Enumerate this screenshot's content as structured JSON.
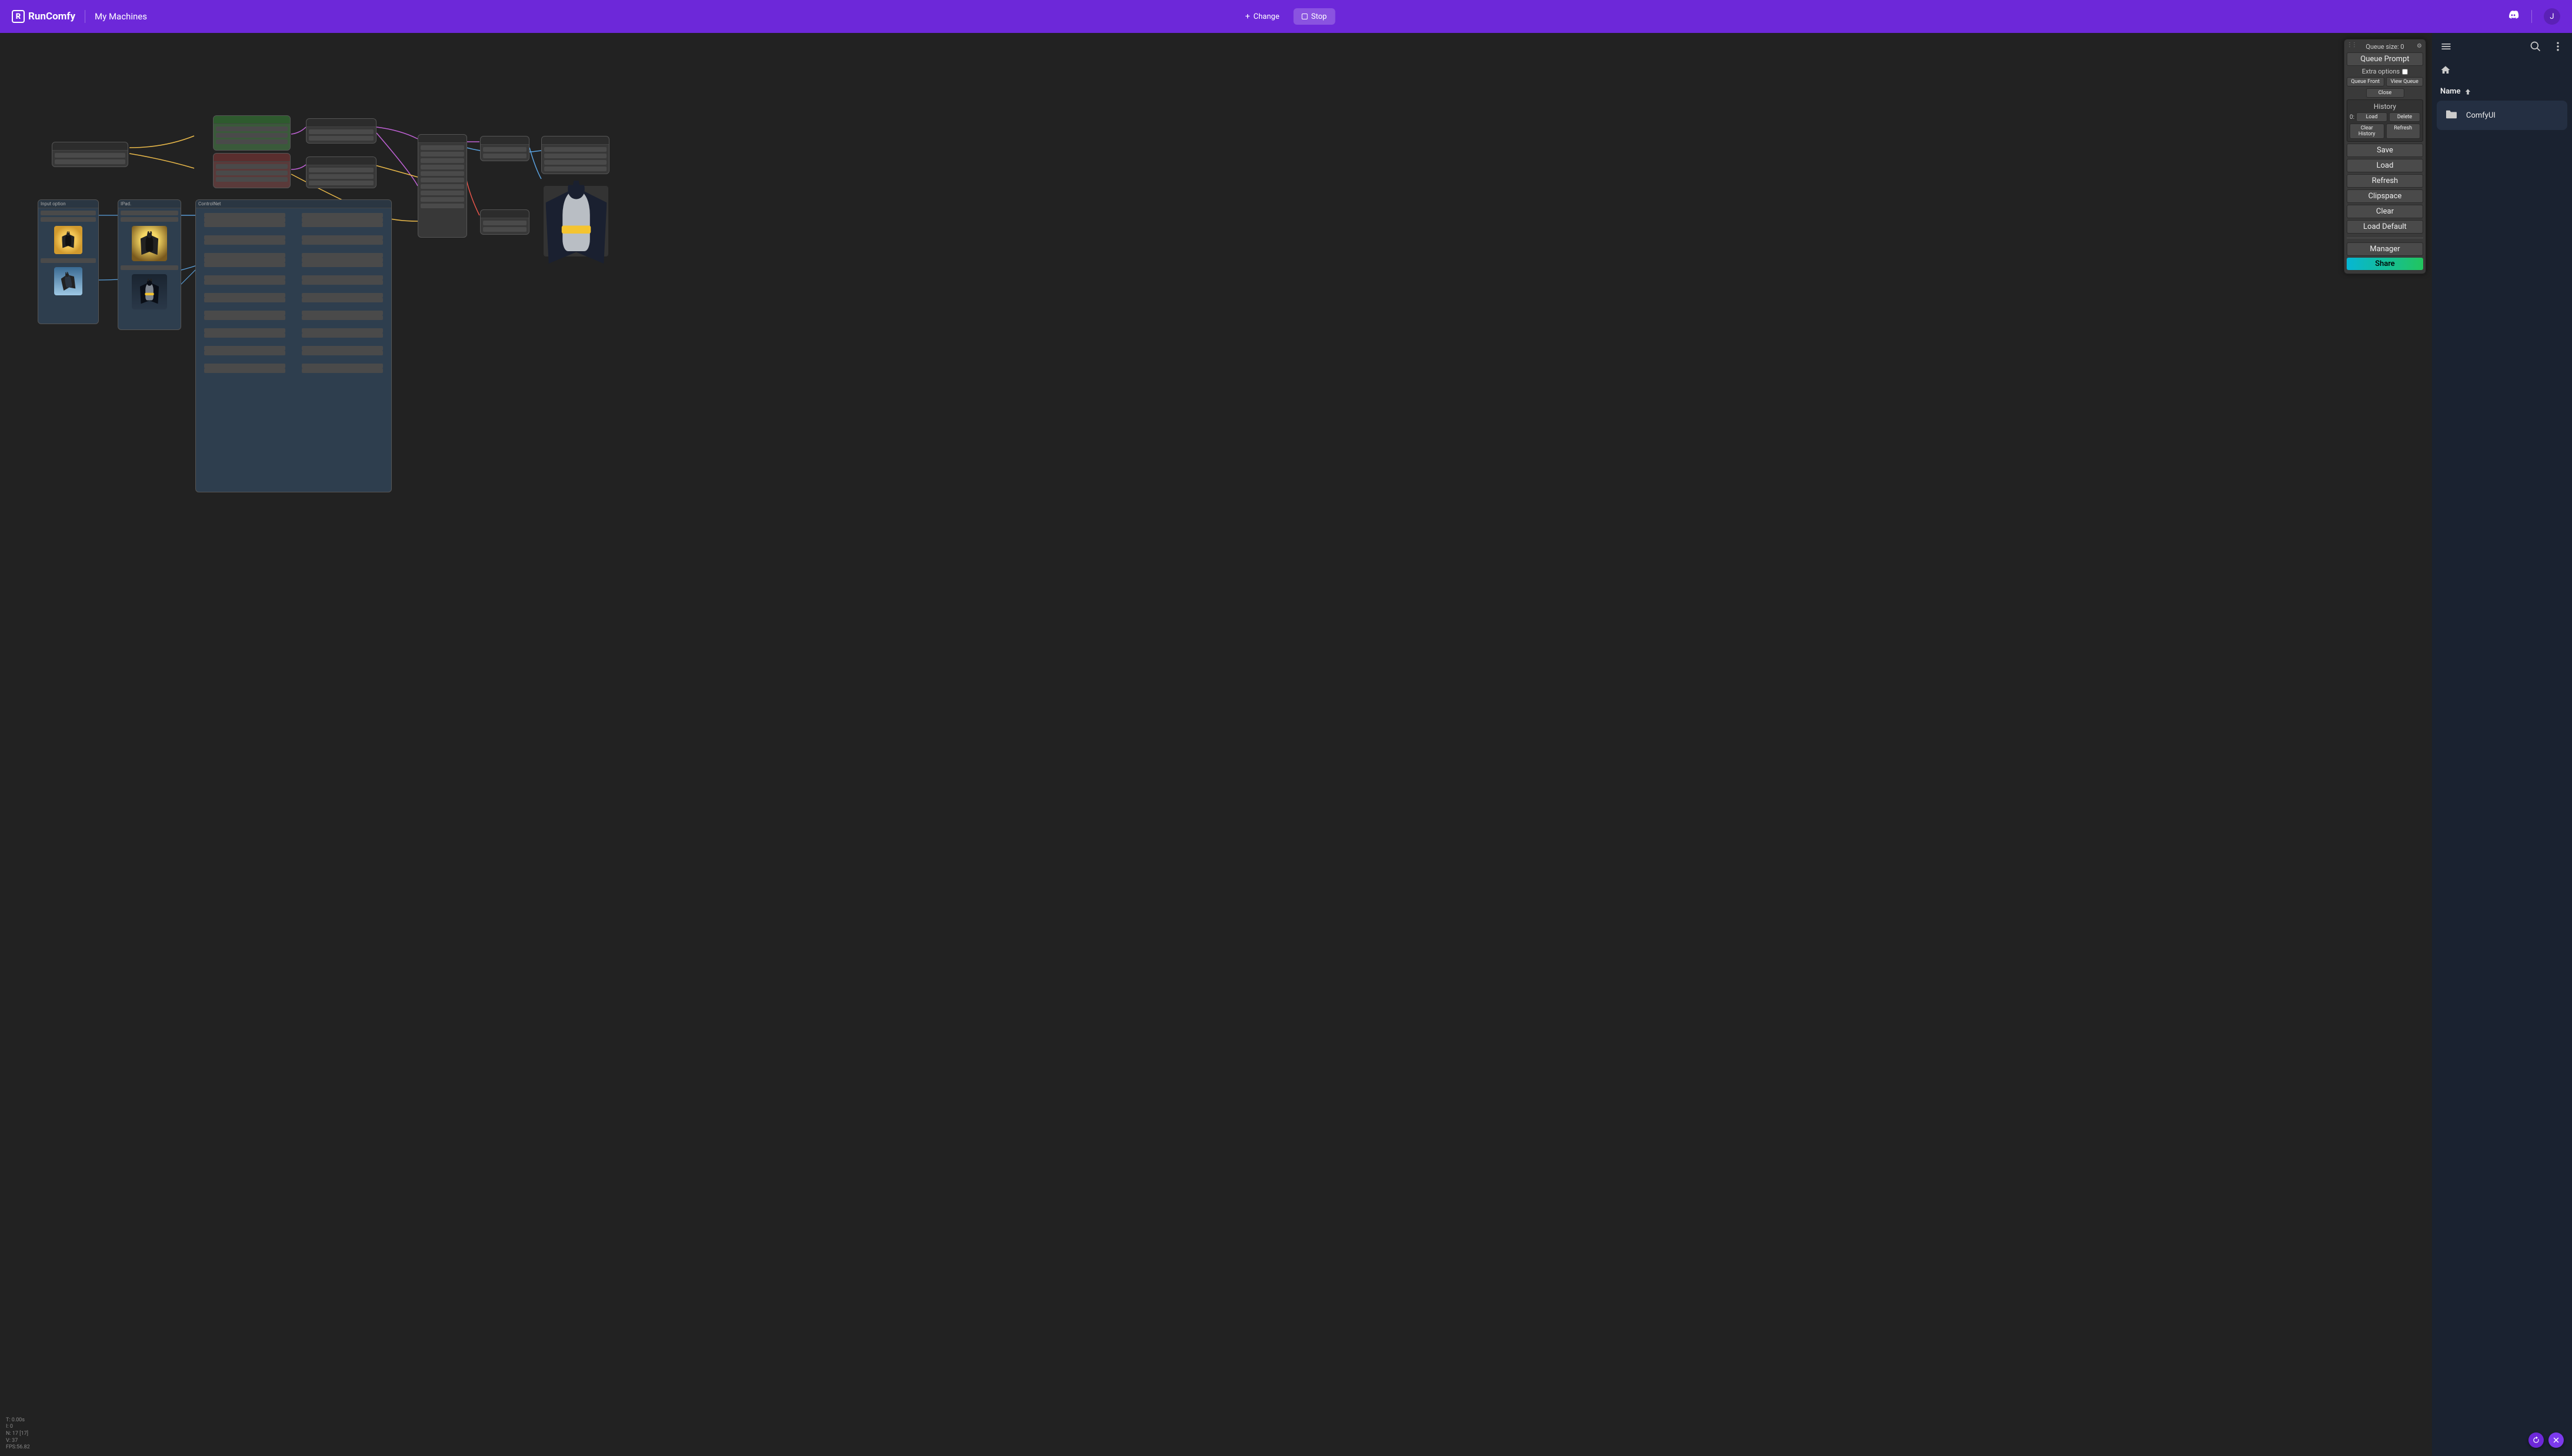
{
  "header": {
    "brand": "RunComfy",
    "logo_letter": "R",
    "my_machines": "My Machines",
    "change": "Change",
    "stop": "Stop",
    "avatar_initial": "J"
  },
  "panel": {
    "queue_size_label": "Queue size: 0",
    "queue_prompt": "Queue Prompt",
    "extra_options": "Extra options",
    "queue_front": "Queue Front",
    "view_queue": "View Queue",
    "close": "Close",
    "history": "History",
    "hist_entry_idx": "0:",
    "load": "Load",
    "delete": "Delete",
    "clear_history": "Clear History",
    "refresh_hist": "Refresh",
    "save": "Save",
    "load_btn": "Load",
    "refresh": "Refresh",
    "clipspace": "Clipspace",
    "clear": "Clear",
    "load_default": "Load Default",
    "manager": "Manager",
    "share": "Share"
  },
  "right": {
    "name_header": "Name",
    "item0": "ComfyUI"
  },
  "hud": {
    "t": "T: 0.00s",
    "i": "I: 0",
    "n": "N: 17 [17]",
    "v": "V: 37",
    "fps": "FPS:56.82"
  },
  "nodes": {
    "input_option": "Input option",
    "ipad": "IPad.",
    "controlnet": "ControlNet"
  }
}
